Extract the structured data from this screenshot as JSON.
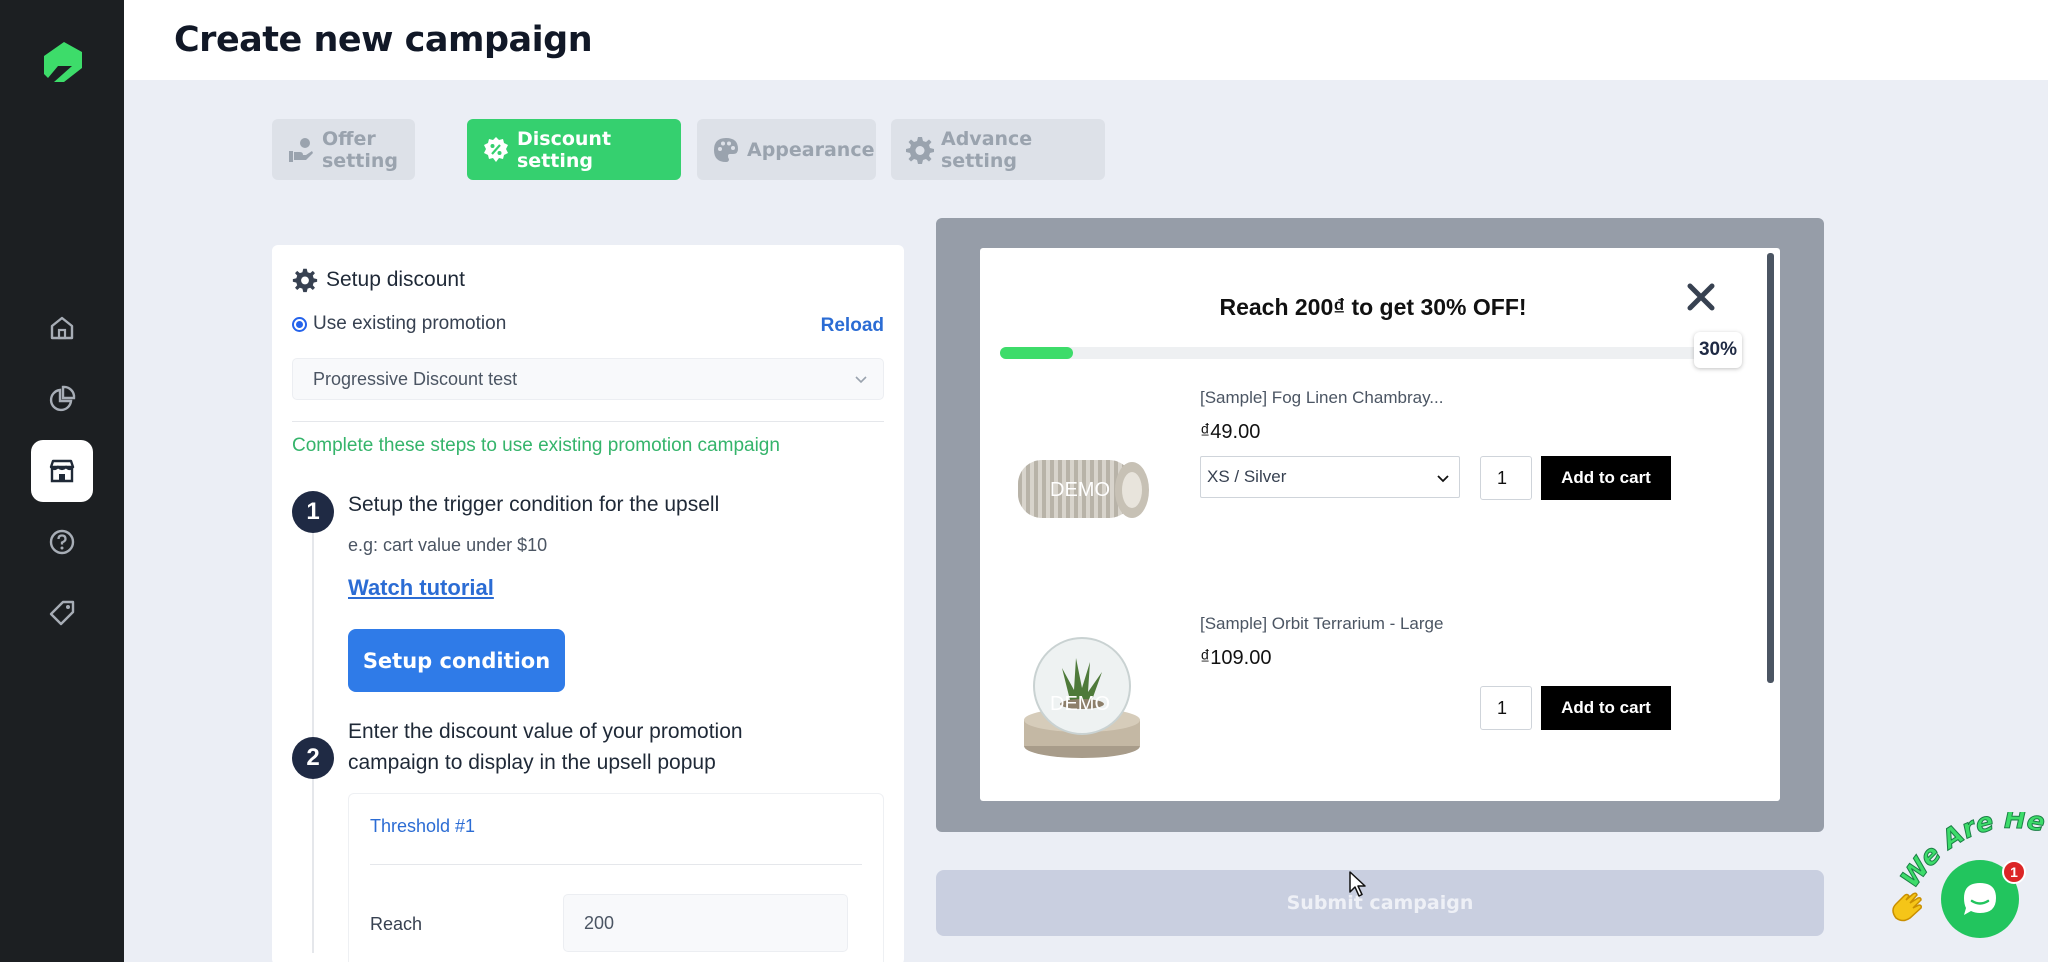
{
  "header": {
    "title": "Create new campaign"
  },
  "tabs": [
    {
      "label": "Offer setting",
      "icon": "hand-coin-icon",
      "active": false
    },
    {
      "label": "Discount setting",
      "icon": "percent-badge-icon",
      "active": true
    },
    {
      "label": "Appearance",
      "icon": "palette-icon",
      "active": false
    },
    {
      "label": "Advance setting",
      "icon": "gear-icon",
      "active": false
    }
  ],
  "sidebar": {
    "items": [
      {
        "name": "home",
        "icon": "home-icon"
      },
      {
        "name": "analytics",
        "icon": "pie-chart-icon"
      },
      {
        "name": "store",
        "icon": "store-icon",
        "active": true
      },
      {
        "name": "help",
        "icon": "help-icon"
      },
      {
        "name": "tags",
        "icon": "tag-icon"
      }
    ]
  },
  "setup": {
    "title": "Setup discount",
    "radio_label": "Use existing promotion",
    "reload_label": "Reload",
    "promotion_value": "Progressive Discount test",
    "steps_hint": "Complete these steps to use existing promotion campaign",
    "step1": {
      "number": "1",
      "title": "Setup the trigger condition for the upsell",
      "example": "e.g: cart value under $10",
      "link": "Watch tutorial",
      "button": "Setup condition"
    },
    "step2": {
      "number": "2",
      "title_line1": "Enter the discount value of your promotion",
      "title_line2": "campaign to display in the upsell popup"
    },
    "threshold": {
      "title": "Threshold #1",
      "reach_label": "Reach",
      "reach_value": "200"
    }
  },
  "preview": {
    "title": "Reach 200₫ to get 30% OFF!",
    "progress_percent": 10,
    "progress_label": "30%",
    "demo_label": "DEMO",
    "products": [
      {
        "name": "[Sample] Fog Linen Chambray...",
        "price": "₫49.00",
        "variant": "XS / Silver",
        "qty": "1",
        "add_label": "Add to cart"
      },
      {
        "name": "[Sample] Orbit Terrarium - Large",
        "price": "₫109.00",
        "qty": "1",
        "add_label": "Add to cart"
      }
    ]
  },
  "submit_label": "Submit campaign",
  "chat": {
    "badge": "1",
    "tagline": "We Are Here!"
  },
  "colors": {
    "accent_green": "#35d06f",
    "link_blue": "#2b6cd4",
    "primary_blue": "#2f7be8",
    "sidebar_bg": "#1c1f22"
  }
}
